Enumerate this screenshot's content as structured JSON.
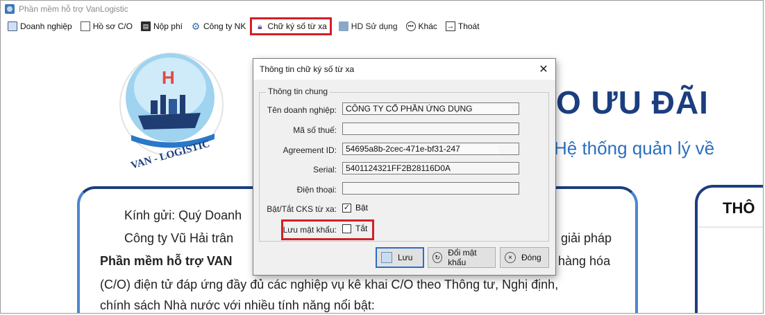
{
  "window": {
    "title": "Phần mềm hỗ trợ VanLogistic"
  },
  "menu": [
    {
      "label": "Doanh nghiệp",
      "icon": "building-icon"
    },
    {
      "label": "Hồ sơ C/O",
      "icon": "file-icon"
    },
    {
      "label": "Nộp phí",
      "icon": "payment-icon"
    },
    {
      "label": "Công ty NK",
      "icon": "gear-icon"
    },
    {
      "label": "Chữ ký số từ xa",
      "icon": "lock-icon"
    },
    {
      "label": "HD Sử dụng",
      "icon": "book-icon"
    },
    {
      "label": "Khác",
      "icon": "more-icon"
    },
    {
      "label": "Thoát",
      "icon": "exit-icon"
    }
  ],
  "background": {
    "logo_text": "VAN - LOGISTIC",
    "hero_title": "O ƯU ĐÃI",
    "hero_subtitle": "Hệ thống quản lý về",
    "right_card_title": "THÔ",
    "letter": {
      "line1": "Kính gửi: Quý Doanh",
      "line2_left": "Công ty Vũ Hải trân",
      "line2_right": "giải pháp",
      "line3_left": "Phần mềm hỗ trợ VAN",
      "line3_right": "hàng hóa",
      "line4": "(C/O) điện tử đáp ứng đầy đủ các nghiệp vụ kê khai C/O theo Thông tư, Nghị định,",
      "line5": "chính sách Nhà nước với nhiều tính năng nổi bật:"
    }
  },
  "dialog": {
    "title": "Thông tin chữ ký số từ xa",
    "group_title": "Thông tin chung",
    "fields": {
      "company_name": {
        "label": "Tên doanh nghiệp:",
        "value": "CÔNG TY CỔ PHẦN ỨNG DỤNG"
      },
      "tax_code": {
        "label": "Mã số thuế:",
        "value": ""
      },
      "agreement_id": {
        "label": "Agreement ID:",
        "value": "54695a8b-2cec-471e-bf31-247"
      },
      "serial": {
        "label": "Serial:",
        "value": "5401124321FF2B28116D0A"
      },
      "phone": {
        "label": "Điện thoại:",
        "value": ""
      }
    },
    "toggle_cks": {
      "label": "Bật/Tắt CKS từ xa:",
      "checked": true,
      "state_label": "Bật"
    },
    "save_password": {
      "label": "Lưu mật khẩu:",
      "checked": false,
      "state_label": "Tắt"
    },
    "buttons": {
      "save": "Lưu",
      "change_password": "Đổi mật khẩu",
      "close": "Đóng"
    }
  },
  "colors": {
    "highlight": "#d21f26",
    "brand_dark": "#1b3e7f",
    "brand_light": "#2a6fc0"
  }
}
